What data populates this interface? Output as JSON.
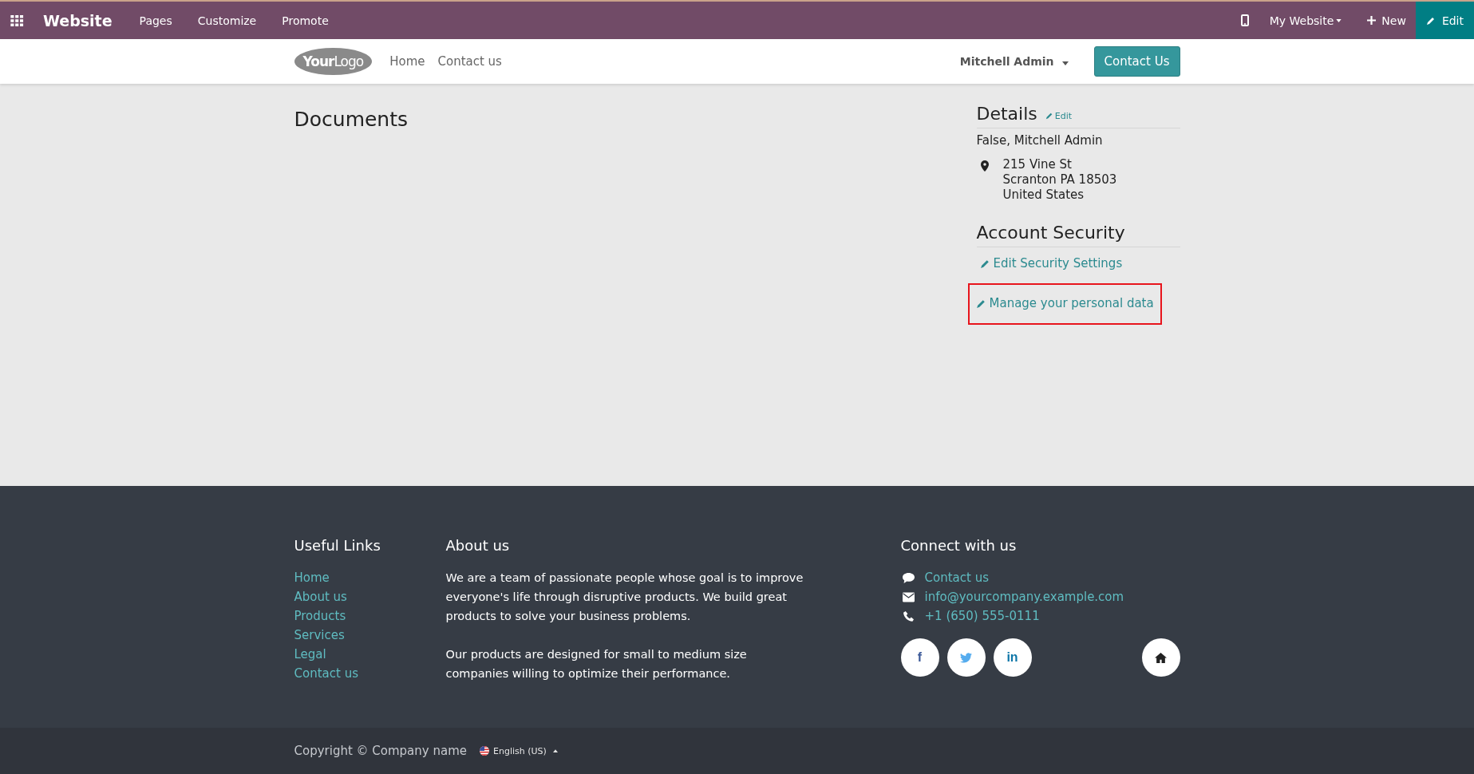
{
  "admin_bar": {
    "app_name": "Website",
    "menu": [
      "Pages",
      "Customize",
      "Promote"
    ],
    "site": "My Website",
    "new": "New",
    "edit": "Edit"
  },
  "header": {
    "logo": "**Your**Logo",
    "nav": [
      "Home",
      "Contact us"
    ],
    "user": "Mitchell Admin",
    "cta": "Contact Us"
  },
  "main": {
    "title": "Documents",
    "details": {
      "title": "Details",
      "edit": "Edit",
      "name": "False, Mitchell Admin",
      "address": [
        "215 Vine St",
        "Scranton PA 18503",
        "United States"
      ]
    },
    "security": {
      "title": "Account Security",
      "links": [
        {
          "label": "Edit Security Settings",
          "highlighted": false
        },
        {
          "label": "Manage your personal data",
          "highlighted": true
        }
      ]
    }
  },
  "footer": {
    "useful_links": {
      "title": "Useful Links",
      "links": [
        "Home",
        "About us",
        "Products",
        "Services",
        "Legal",
        "Contact us"
      ]
    },
    "about": {
      "title": "About us",
      "paragraphs": [
        "We are a team of passionate people whose goal is to improve everyone's life through disruptive products. We build great products to solve your business problems.",
        "Our products are designed for small to medium size companies willing to optimize their performance."
      ]
    },
    "connect": {
      "title": "Connect with us",
      "items": [
        {
          "kind": "chat",
          "text": "Contact us"
        },
        {
          "kind": "mail",
          "text": "info@yourcompany.example.com"
        },
        {
          "kind": "phone",
          "text": "+1 (650) 555-0111"
        }
      ],
      "social": [
        {
          "kind": "facebook",
          "label": "f"
        },
        {
          "kind": "twitter"
        },
        {
          "kind": "linkedin",
          "label": "in"
        },
        {
          "kind": "home"
        }
      ]
    }
  },
  "copyright": {
    "text": "Copyright © Company name",
    "language": "English (US)"
  }
}
